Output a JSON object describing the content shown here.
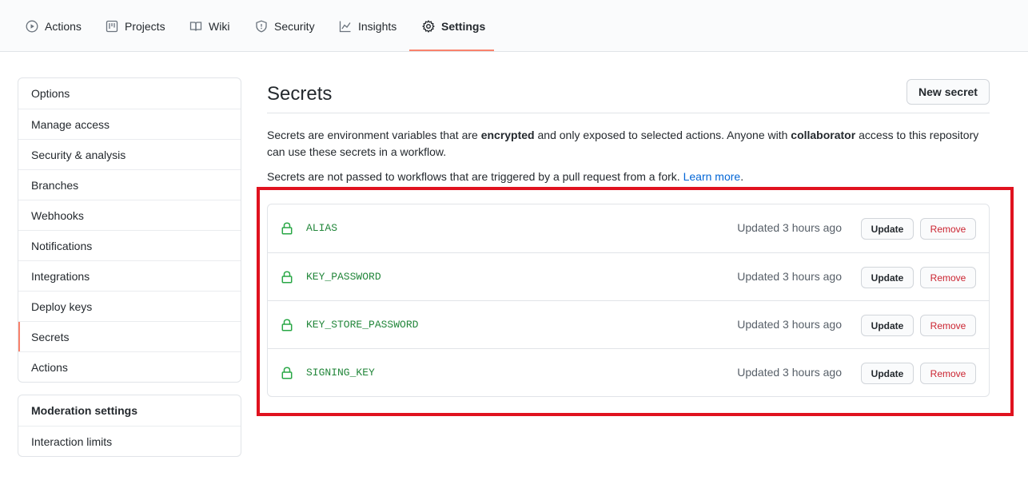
{
  "topnav": {
    "tabs": [
      {
        "label": "Actions",
        "icon": "play-icon"
      },
      {
        "label": "Projects",
        "icon": "project-icon"
      },
      {
        "label": "Wiki",
        "icon": "book-icon"
      },
      {
        "label": "Security",
        "icon": "shield-icon"
      },
      {
        "label": "Insights",
        "icon": "graph-icon"
      },
      {
        "label": "Settings",
        "icon": "gear-icon",
        "selected": true
      }
    ]
  },
  "sidebar": {
    "items": [
      {
        "label": "Options"
      },
      {
        "label": "Manage access"
      },
      {
        "label": "Security & analysis"
      },
      {
        "label": "Branches"
      },
      {
        "label": "Webhooks"
      },
      {
        "label": "Notifications"
      },
      {
        "label": "Integrations"
      },
      {
        "label": "Deploy keys"
      },
      {
        "label": "Secrets",
        "selected": true
      },
      {
        "label": "Actions"
      }
    ],
    "moderation": {
      "heading": "Moderation settings",
      "items": [
        {
          "label": "Interaction limits"
        }
      ]
    }
  },
  "main": {
    "title": "Secrets",
    "new_secret_label": "New secret",
    "description1": {
      "part1": "Secrets are environment variables that are ",
      "bold1": "encrypted",
      "part2": " and only exposed to selected actions. Anyone with ",
      "bold2": "collaborator",
      "part3": " access to this repository can use these secrets in a workflow."
    },
    "description2": {
      "text": "Secrets are not passed to workflows that are triggered by a pull request from a fork. ",
      "link": "Learn more",
      "end": "."
    },
    "secrets": [
      {
        "name": "ALIAS",
        "updated": "Updated 3 hours ago",
        "update_label": "Update",
        "remove_label": "Remove"
      },
      {
        "name": "KEY_PASSWORD",
        "updated": "Updated 3 hours ago",
        "update_label": "Update",
        "remove_label": "Remove"
      },
      {
        "name": "KEY_STORE_PASSWORD",
        "updated": "Updated 3 hours ago",
        "update_label": "Update",
        "remove_label": "Remove"
      },
      {
        "name": "SIGNING_KEY",
        "updated": "Updated 3 hours ago",
        "update_label": "Update",
        "remove_label": "Remove"
      }
    ]
  },
  "colors": {
    "accent_underline": "#f9826c",
    "secret_name": "#22863a",
    "remove_text": "#cb2431",
    "link": "#0366d6",
    "highlight_border": "#e0121f"
  }
}
